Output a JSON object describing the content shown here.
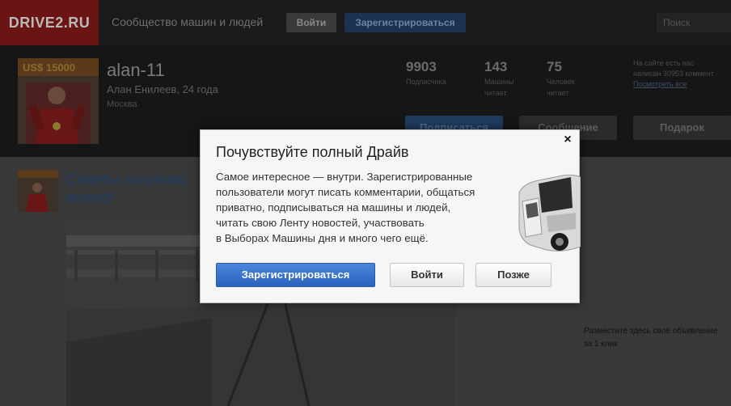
{
  "topbar": {
    "logo": "DRIVE2.RU",
    "tagline": "Сообщество машин и людей",
    "login_label": "Войти",
    "register_label": "Зарегистрироваться",
    "search_placeholder": "Поиск"
  },
  "profile": {
    "photo_caption": "US$ 15000",
    "name": "alan-11",
    "subtitle": "Алан Енилеев, 24 года",
    "city": "Москва",
    "stats": [
      {
        "value": "9903",
        "label_line1": "Подписчика",
        "label_line2": ""
      },
      {
        "value": "143",
        "label_line1": "Машины",
        "label_line2": "читает"
      },
      {
        "value": "75",
        "label_line1": "Человек",
        "label_line2": "читает"
      }
    ],
    "side_note_line1": "На сайте есть нас",
    "side_note_line2": "написан 30953 коммент",
    "side_note_link": "Посмотреть все",
    "follow_label": "Подписаться",
    "message_label": "Сообщение",
    "gift_label": "Подарок"
  },
  "post": {
    "title": "Советы начинающим — это важно!",
    "title_visible": "Советы начинаю важно!"
  },
  "ad_note": {
    "line1": "Разместите здесь своё объявление",
    "line2": "за 1 клик"
  },
  "modal": {
    "close_label": "×",
    "title": "Почувствуйте полный Драйв",
    "body_lines": [
      "Самое интересное — внутри. Зарегистрированные",
      "пользователи могут писать комментарии, общаться",
      "приватно, подписываться на машины и людей,",
      "читать свою Ленту новостей, участвовать",
      "в Выборах Машины дня и много чего ещё."
    ],
    "register_label": "Зарегистрироваться",
    "login_label": "Войти",
    "later_label": "Позже"
  },
  "colors": {
    "logo_bg": "#6a1414",
    "primary_blue": "#2a62bd",
    "modal_bg": "#f6f6f6"
  }
}
